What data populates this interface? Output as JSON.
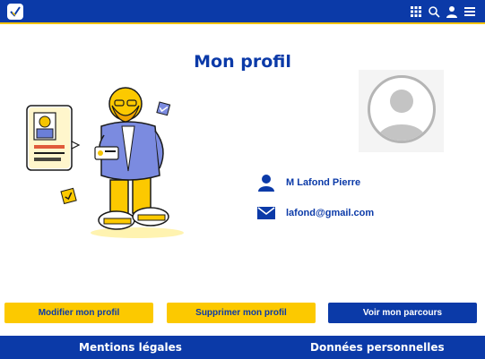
{
  "header": {
    "icons": [
      "app-logo-icon",
      "grid-icon",
      "search-icon",
      "user-icon",
      "menu-icon"
    ]
  },
  "page": {
    "title": "Mon profil"
  },
  "profile": {
    "name": "M  Lafond Pierre",
    "email": "lafond@gmail.com"
  },
  "actions": {
    "edit_label": "Modifier mon profil",
    "delete_label": "Supprimer mon profil",
    "journey_label": "Voir mon parcours"
  },
  "footer": {
    "legal_label": "Mentions légales",
    "data_label": "Données personnelles"
  },
  "colors": {
    "brand_blue": "#0b3aa8",
    "accent_yellow": "#fcc900"
  }
}
